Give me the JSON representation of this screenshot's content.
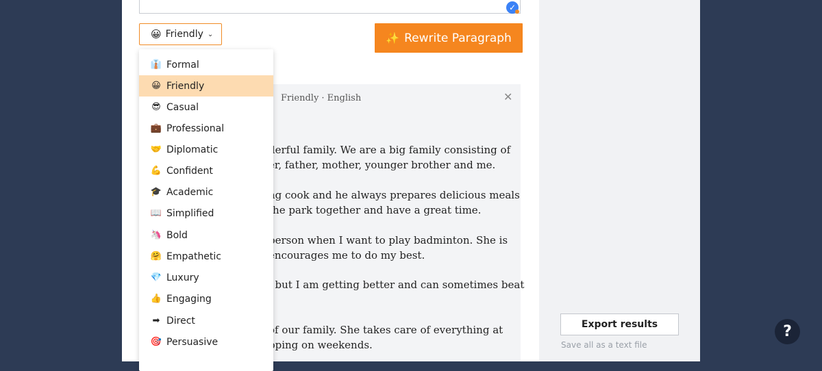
{
  "tone_button": {
    "emoji": "😀",
    "label": "Friendly"
  },
  "rewrite_button": {
    "label": "Rewrite Paragraph"
  },
  "result": {
    "meta": "Friendly · English",
    "paragraphs": [
      [
        "derful family. We are a big family consisting of",
        "er, father, mother, younger brother and me."
      ],
      [
        "ng cook and he always prepares delicious meals",
        "the park together and have a great time."
      ],
      [
        "person when I want to play badminton. She is",
        "encourages me to do my best."
      ],
      [
        ", but I am getting better and can sometimes beat",
        ""
      ],
      [
        "of our family. She takes care of everything at",
        "pping on weekends."
      ]
    ]
  },
  "tone_menu": [
    {
      "emoji": "👔",
      "label": "Formal"
    },
    {
      "emoji": "😀",
      "label": "Friendly",
      "selected": true
    },
    {
      "emoji": "😎",
      "label": "Casual"
    },
    {
      "emoji": "💼",
      "label": "Professional"
    },
    {
      "emoji": "🤝",
      "label": "Diplomatic"
    },
    {
      "emoji": "💪",
      "label": "Confident"
    },
    {
      "emoji": "🎓",
      "label": "Academic"
    },
    {
      "emoji": "📖",
      "label": "Simplified"
    },
    {
      "emoji": "🦄",
      "label": "Bold"
    },
    {
      "emoji": "🤗",
      "label": "Empathetic"
    },
    {
      "emoji": "💎",
      "label": "Luxury"
    },
    {
      "emoji": "👍",
      "label": "Engaging"
    },
    {
      "emoji": "➡",
      "label": "Direct"
    },
    {
      "emoji": "🎯",
      "label": "Persuasive"
    }
  ],
  "export": {
    "label": "Export results",
    "hint": "Save all as a text file"
  },
  "help": {
    "label": "?"
  },
  "colors": {
    "accent": "#f5861f",
    "selected_bg": "#fddbb1",
    "backdrop": "#2d3b55"
  }
}
